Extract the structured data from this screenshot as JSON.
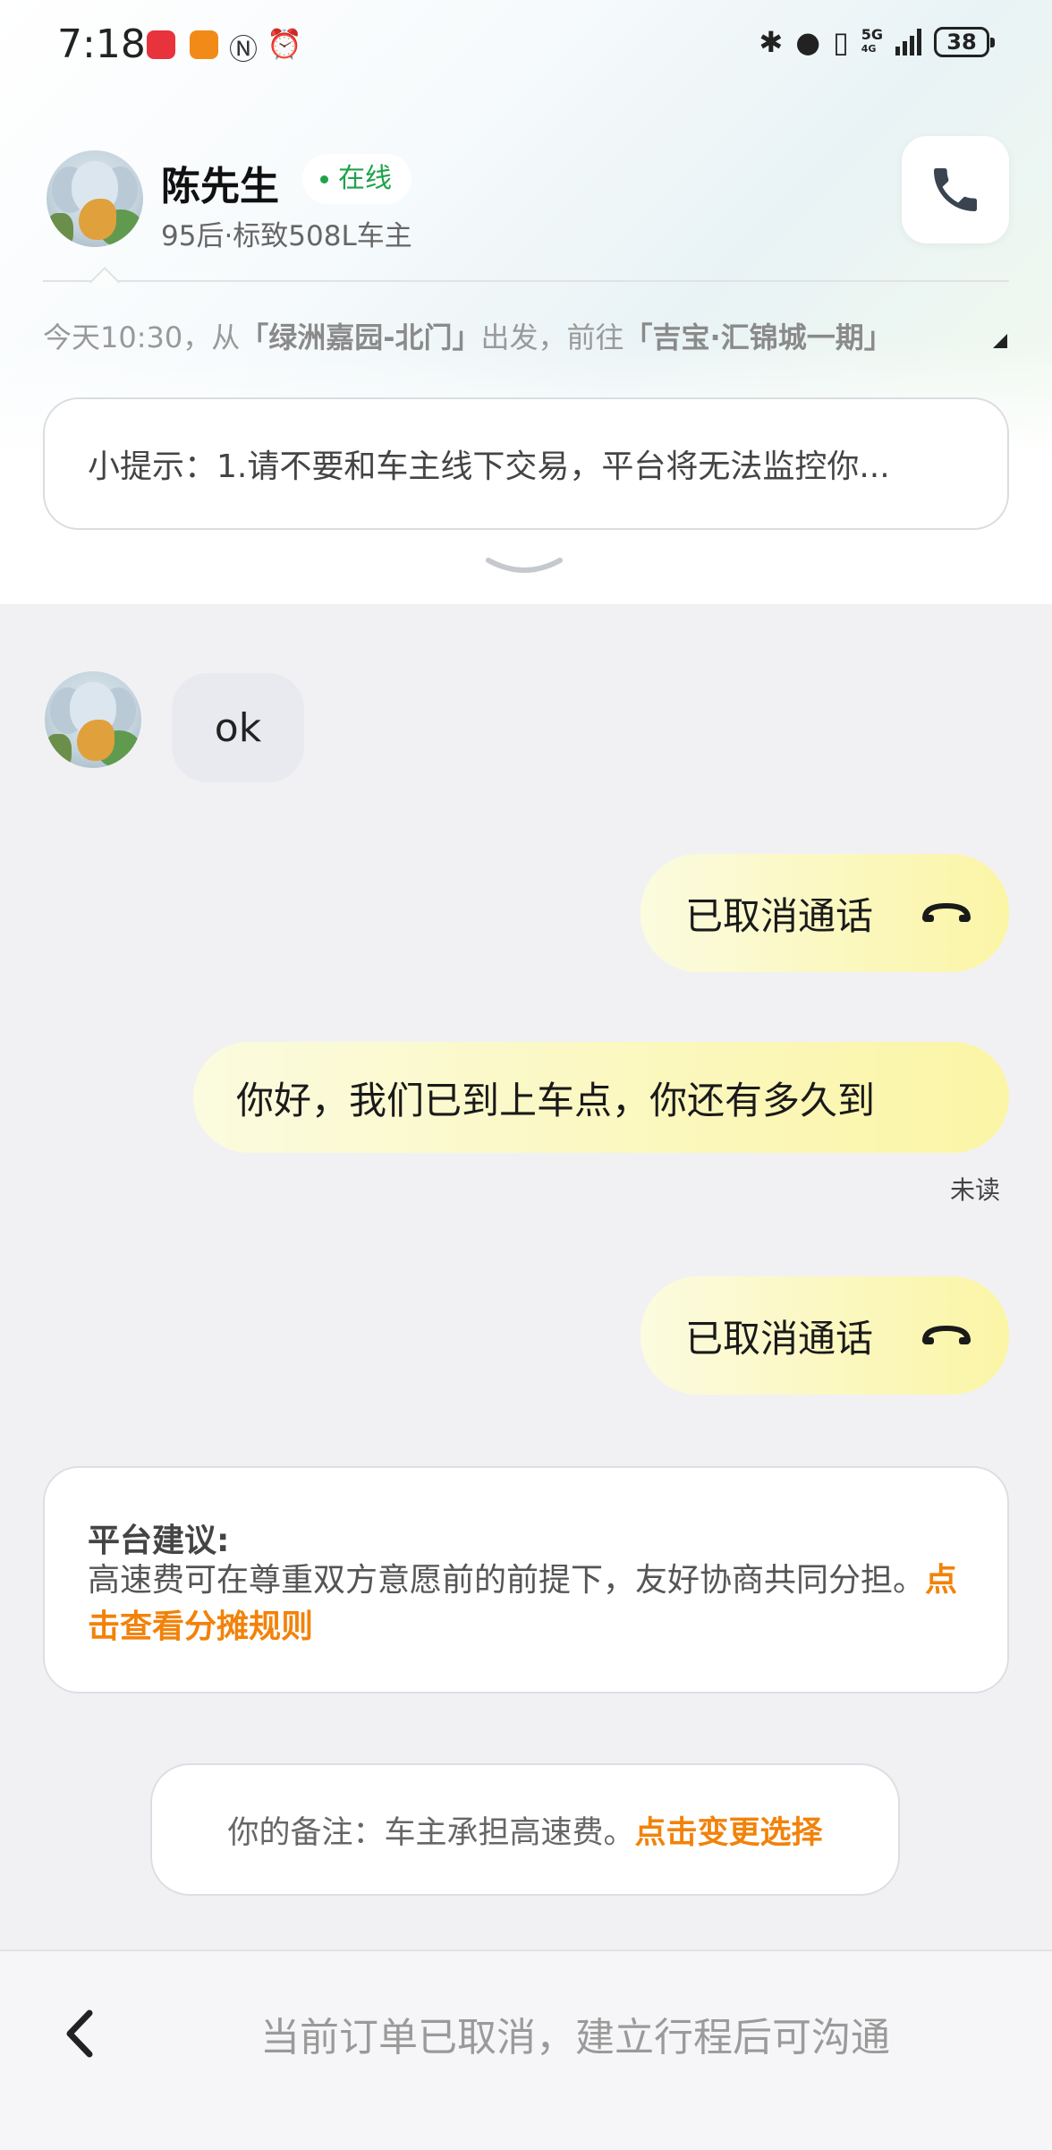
{
  "status_bar": {
    "time": "7:18",
    "battery": "38",
    "network": "5G",
    "network_sub": "4G",
    "app_icon_colors": [
      "#e8333d",
      "#f28a18"
    ]
  },
  "header": {
    "name": "陈先生",
    "status": "在线",
    "subtitle": "95后·标致508L车主",
    "call_icon": "phone-icon"
  },
  "trip": {
    "prefix": "今天10:30，从",
    "origin": "「绿洲嘉园-北门」",
    "middle": "出发，前往",
    "destination": "「吉宝·汇锦城一期」"
  },
  "tip": {
    "text": "小提示：1.请不要和车主线下交易，平台将无法监控你..."
  },
  "messages": {
    "incoming_1": "ok",
    "outgoing_1": "已取消通话",
    "outgoing_2": "你好，我们已到上车点，你还有多久到",
    "outgoing_2_status": "未读",
    "outgoing_3": "已取消通话"
  },
  "suggestion": {
    "title": "平台建议:",
    "body": "高速费可在尊重双方意愿前的前提下，友好协商共同分担。",
    "link": "点击查看分摊规则"
  },
  "note": {
    "text": "你的备注：车主承担高速费。",
    "link": "点击变更选择"
  },
  "bottom": {
    "text": "当前订单已取消，建立行程后可沟通"
  },
  "colors": {
    "accent_orange": "#f2820a",
    "online_green": "#1da34a",
    "bubble_yellow": "#fbf5a6"
  }
}
